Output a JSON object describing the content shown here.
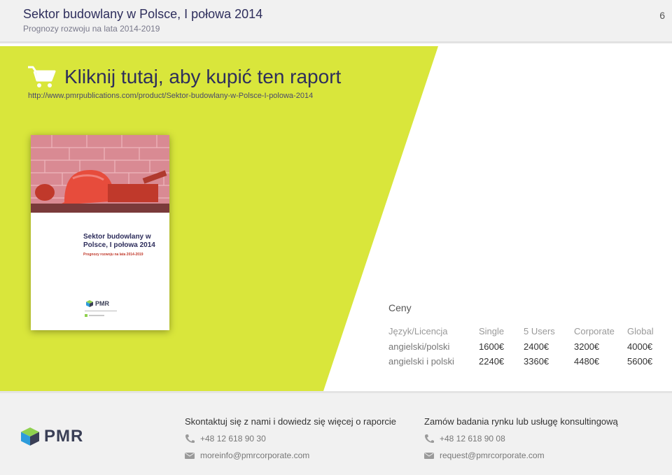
{
  "header": {
    "title": "Sektor budowlany w Polsce, I połowa 2014",
    "subtitle": "Prognozy rozwoju na lata 2014-2019",
    "page_number": "6"
  },
  "cta": {
    "label": "Kliknij tutaj, aby kupić ten raport",
    "url": "http://www.pmrpublications.com/product/Sektor-budowlany-w-Polsce-I-polowa-2014"
  },
  "cover": {
    "title": "Sektor budowlany w Polsce, I połowa 2014",
    "subtitle": "Prognozy rozwoju na lata 2014-2019",
    "logo_text": "PMR"
  },
  "prices": {
    "title": "Ceny",
    "headers": [
      "Język/Licencja",
      "Single",
      "5 Users",
      "Corporate",
      "Global"
    ],
    "rows": [
      [
        "angielski/polski",
        "1600€",
        "2400€",
        "3200€",
        "4000€"
      ],
      [
        "angielski i polski",
        "2240€",
        "3360€",
        "4480€",
        "5600€"
      ]
    ]
  },
  "footer": {
    "logo_text": "PMR",
    "contact": {
      "heading": "Skontaktuj się z nami i dowiedz się więcej o raporcie",
      "phone": "+48 12 618 90 30",
      "email": "moreinfo@pmrcorporate.com"
    },
    "order": {
      "heading": "Zamów badania rynku lub usługę konsultingową",
      "phone": "+48 12 618 90 08",
      "email": "request@pmrcorporate.com"
    }
  },
  "colors": {
    "accent_green": "#d9e63b",
    "title_navy": "#2e2e5c",
    "header_bg": "#f1f1f1"
  }
}
